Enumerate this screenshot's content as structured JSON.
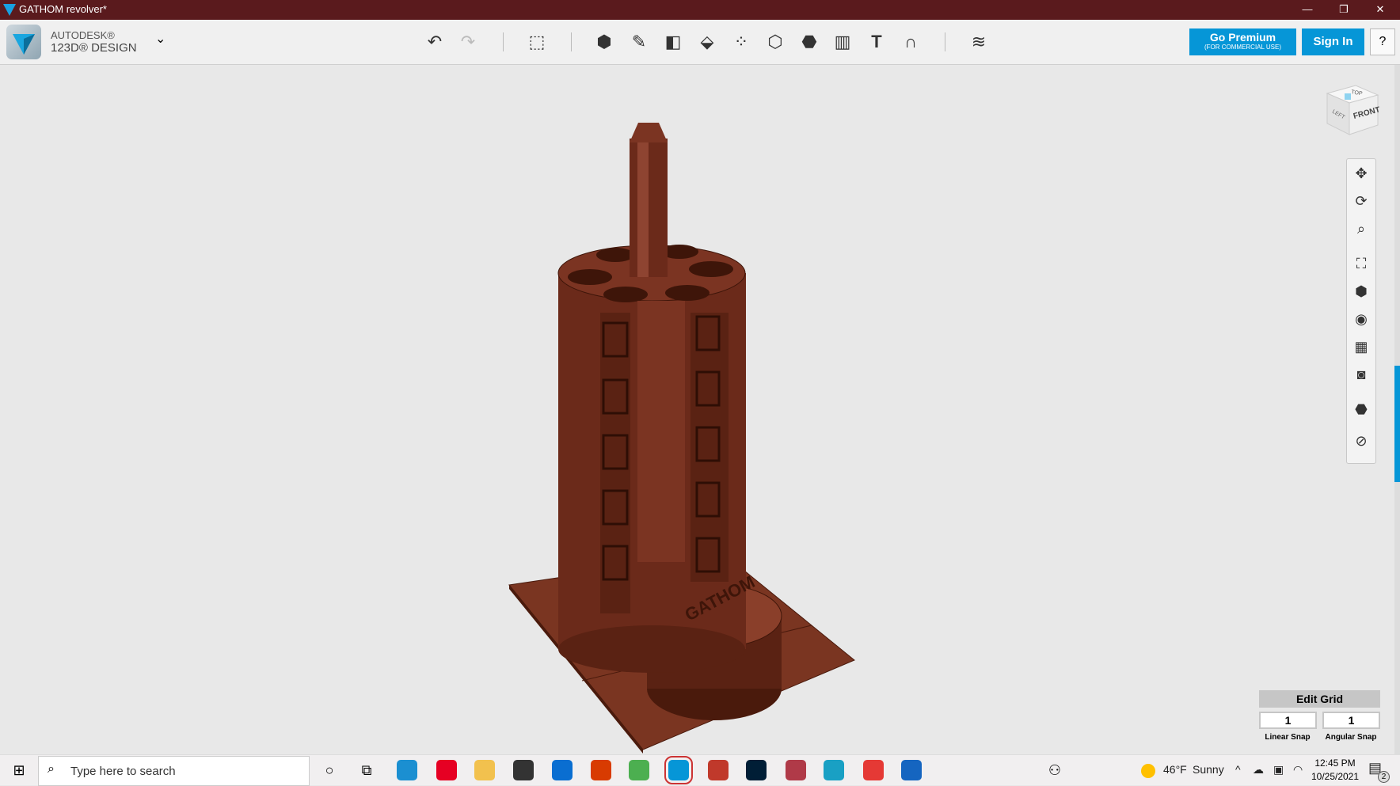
{
  "window": {
    "title": "GATHOM revolver*"
  },
  "brand": {
    "line1": "AUTODESK®",
    "line2": "123D® DESIGN"
  },
  "toolbar": {
    "premium_label": "Go Premium",
    "premium_sub": "(FOR COMMERCIAL USE)",
    "signin_label": "Sign In",
    "help_label": "?",
    "tools": [
      "undo-icon",
      "redo-icon",
      "transform-icon",
      "primitives-icon",
      "sketch-icon",
      "construct-icon",
      "modify-icon",
      "pattern-icon",
      "group-icon",
      "combine-icon",
      "measure-icon",
      "text-icon",
      "snap-icon",
      "material-icon"
    ]
  },
  "viewcube": {
    "top": "TOP",
    "front": "FRONT",
    "left": "LEFT"
  },
  "nav_tools": [
    "pan-icon",
    "orbit-icon",
    "zoom-icon",
    "fit-icon",
    "views-icon",
    "visibility-icon",
    "grid-icon",
    "screenshot-icon",
    "material-view-icon",
    "hide-icon"
  ],
  "grid": {
    "title": "Edit Grid",
    "linear_value": "1",
    "angular_value": "1",
    "linear_label": "Linear Snap",
    "angular_label": "Angular Snap"
  },
  "model": {
    "embossed_text": "GATHOM",
    "colors": {
      "body": "#6b2a1a",
      "light": "#8e4431",
      "dark": "#3e1509"
    }
  },
  "taskbar": {
    "search_placeholder": "Type here to search",
    "weather": "46°F",
    "weather_desc": "Sunny",
    "time": "12:45 PM",
    "date": "10/25/2021",
    "notifications": "2",
    "apps": [
      {
        "name": "edge",
        "color": "#1b8fd1"
      },
      {
        "name": "pinterest",
        "color": "#e60023"
      },
      {
        "name": "file-explorer",
        "color": "#f2c14e"
      },
      {
        "name": "store",
        "color": "#333"
      },
      {
        "name": "mail",
        "color": "#0a6ed1"
      },
      {
        "name": "office",
        "color": "#d83b01"
      },
      {
        "name": "chrome",
        "color": "#4caf50"
      },
      {
        "name": "123d-design",
        "color": "#0696d7"
      },
      {
        "name": "app-red",
        "color": "#c0392b"
      },
      {
        "name": "photoshop",
        "color": "#001e36"
      },
      {
        "name": "app-gem",
        "color": "#b03a48"
      },
      {
        "name": "app-c",
        "color": "#19a0c4"
      },
      {
        "name": "app-cube",
        "color": "#e53935"
      },
      {
        "name": "photos",
        "color": "#1565c0"
      }
    ]
  }
}
